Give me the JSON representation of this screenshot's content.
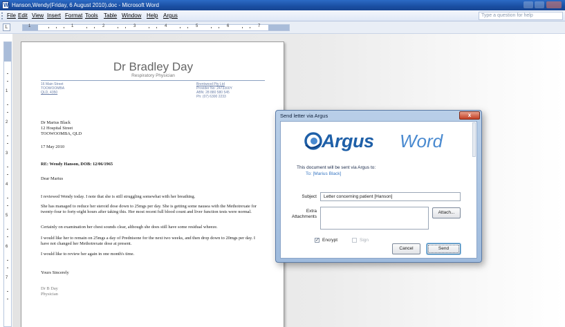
{
  "window": {
    "title": "Hanson,Wendy(Friday, 6 August 2010).doc - Microsoft Word"
  },
  "menubar": {
    "items": [
      "File",
      "Edit",
      "View",
      "Insert",
      "Format",
      "Tools",
      "Table",
      "Window",
      "Help",
      "Argus"
    ],
    "help_search_placeholder": "Type a question for help"
  },
  "ruler": {
    "tab_selector": "L",
    "h_numbers": [
      "1",
      "1",
      "2",
      "3",
      "4",
      "5",
      "6",
      "7"
    ],
    "v_numbers": [
      "1",
      "2",
      "3",
      "4",
      "5",
      "6",
      "7"
    ]
  },
  "letter": {
    "doctor_name": "Dr Bradley Day",
    "doctor_role": "Respiratory Physician",
    "address_left": [
      "16 Main Street",
      "TOOWOOMBA",
      "QLD, 4350"
    ],
    "address_right_labels": [
      "Provider No:",
      "ABN:",
      "Ph:"
    ],
    "address_company": "Brentwood Pty Ltd",
    "address_right_values": [
      "2473300Y",
      "28 880 580 545",
      "(07) 6300 2233"
    ],
    "recipient_lines": [
      "Dr Marius Black",
      "12 Hospital Street",
      "TOOWOOMBA, QLD"
    ],
    "date": "17 May 2010",
    "re_line": "RE: Wendy Hanson, DOB: 12/06/1965",
    "salutation": "Dear Marius",
    "paragraphs": [
      "I reviewed Wendy today. I note that she is still struggling somewhat with her breathing.",
      "She has managed to reduce her steroid dose down to 25mgs per day. She is getting some nausea with the Methotrexate for twenty-four to forty-eight hours after taking this. Her most recent full blood count and liver function tests were normal.",
      "Certainly on examination her chest sounds clear, although she does still have some residual wheeze.",
      "I would like her to remain on 25mgs a day of Prednisone for the next two weeks, and then drop down to 20mgs per day. I have not changed her Methotrexate dose at present.",
      "I would like to review her again in one month's time."
    ],
    "closing": "Yours Sincerely",
    "signature_name": "Dr B Day",
    "signature_role": "Physician"
  },
  "dialog": {
    "title": "Send letter via Argus",
    "close_glyph": "x",
    "brand_name": "Argus",
    "brand_product": "Word",
    "intro": "This document will be sent via Argus to:",
    "recipient": "To: [Marius Black]",
    "subject_label": "Subject",
    "subject_value": "Letter concerning patient [Hanson]",
    "attachments_label_line1": "Extra",
    "attachments_label_line2": "Attachments",
    "attach_button": "Attach...",
    "encrypt_label": "Encrypt",
    "encrypt_checked": true,
    "sign_label": "Sign",
    "sign_checked": false,
    "check_glyph": "✓",
    "cancel_button": "Cancel",
    "send_button": "Send"
  },
  "colors": {
    "titlebar": "#1a4fa3",
    "brand_blue": "#1f60a8",
    "brand_light_blue": "#4a8ad0",
    "link_blue": "#3877c3"
  }
}
